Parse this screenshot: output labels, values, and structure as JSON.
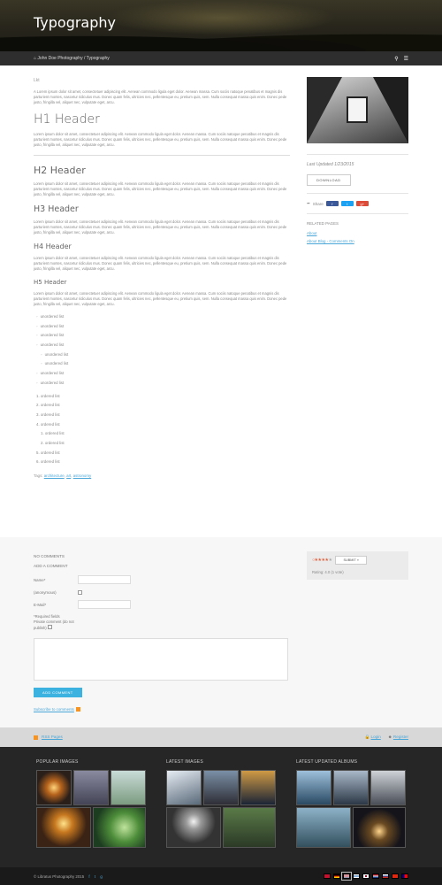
{
  "hero": {
    "title": "Typography"
  },
  "breadcrumb": {
    "home": "John Doe Photography",
    "separator": "/",
    "current": "Typography"
  },
  "content": {
    "tag": "Lkt",
    "lorem": "A Lorem ipsum dolor sit amet, consectetuer adipiscing elit. Aenean commodo ligula eget dolor. Aenean massa. Cum sociis natoque penatibus et magnis dis parturient montes, nascetur ridiculus mus. Donec quam felis, ultricies nec, pellentesque eu, pretium quis, sem. Nulla consequat massa quis enim. Donec pede justo, fringilla vel, aliquet nec, vulputate eget, arcu.",
    "lorem2": "Lorem ipsum dolor sit amet, consectetuer adipiscing elit. Aenean commodo ligula eget dolor. Aenean massa. Cum sociis natoque penatibus et magnis dis parturient montes, nascetur ridiculus mus. Donec quam felis, ultricies nec, pellentesque eu, pretium quis, sem. Nulla consequat massa quis enim. Donec pede justo, fringilla vel, aliquet nec, vulputate eget, arcu.",
    "h1": "H1 Header",
    "h2": "H2 Header",
    "h3": "H3 Header",
    "h4": "H4 Header",
    "h5": "H5 Header",
    "unordered": "unordered list",
    "ordered": "ordered list",
    "tags_label": "Tags:",
    "tags": [
      "architecture",
      "art",
      "astronomy"
    ]
  },
  "sidebar": {
    "last_updated": "Last Updated 1/23/2015",
    "download": "DOWNLOAD",
    "share_label": "Share",
    "related_heading": "RELATED PAGES",
    "related": [
      "About",
      "About Blog - Comments On"
    ]
  },
  "comments": {
    "heading": "NO COMMENTS",
    "add": "ADD A COMMENT",
    "name_label": "Name*",
    "anon_label": "(anonymous)",
    "email_label": "E-Mail*",
    "required_note": "*Required fields",
    "private_label": "Private comment (do not publish)",
    "submit": "ADD COMMENT",
    "subscribe": "Subscribe to comments"
  },
  "rating": {
    "submit": "SUBMIT »",
    "text": "Rating: 4.0 (1 vote)",
    "stars": 4
  },
  "bar": {
    "rss": "RSS Pages",
    "login": "Login",
    "register": "Register"
  },
  "footer": {
    "popular": "POPULAR IMAGES",
    "latest": "LATEST IMAGES",
    "albums": "LATEST UPDATED ALBUMS",
    "copyright": "© Libratus Photography 2015"
  },
  "colors": {
    "accent": "#4ba7d8",
    "button": "#3bb2e0",
    "facebook": "#3b5998",
    "twitter": "#1da1f2",
    "google": "#dd4b39"
  }
}
